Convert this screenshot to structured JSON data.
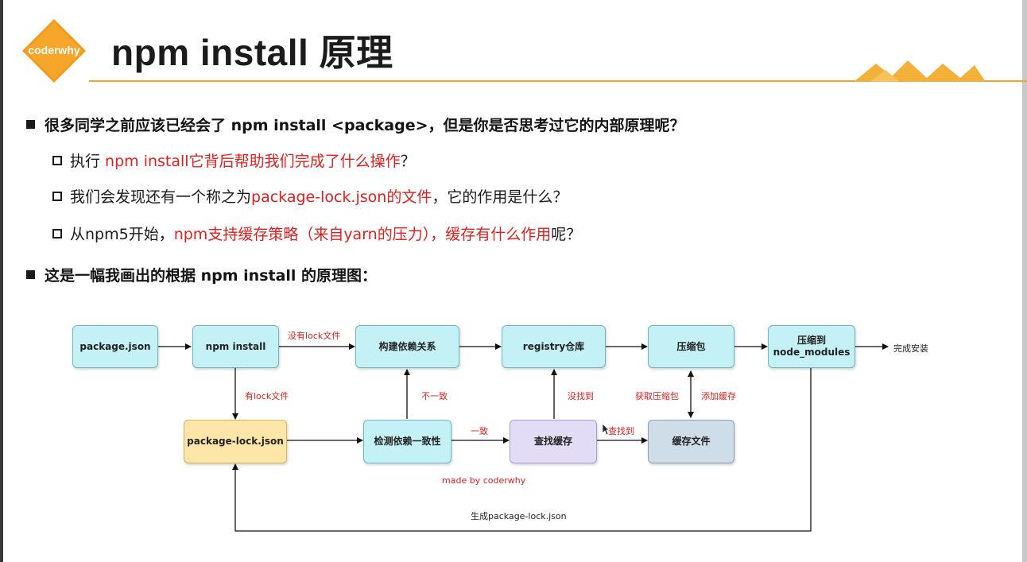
{
  "header": {
    "logo_text": "coderwhy",
    "title": "npm install 原理"
  },
  "bullets": {
    "b1": "很多同学之前应该已经会了 npm install <package>，但是你是否思考过它的内部原理呢？",
    "s1_a": "执行 ",
    "s1_b": "npm install它背后帮助我们完成了什么操作",
    "s1_c": "？",
    "s2_a": "我们会发现还有一个称之为",
    "s2_b": "package-lock.json的文件",
    "s2_c": "，它的作用是什么？",
    "s3_a": "从npm5开始，",
    "s3_b": "npm支持缓存策略（来自yarn的压力），缓存有什么作用",
    "s3_c": "呢？",
    "b2": "这是一幅我画出的根据 npm install 的原理图："
  },
  "diagram": {
    "nodes": {
      "package_json": "package.json",
      "npm_install": "npm install",
      "build_deps": "构建依赖关系",
      "registry": "registry仓库",
      "tarball": "压缩包",
      "extract_line1": "压缩到",
      "extract_line2": "node_modules",
      "package_lock": "package-lock.json",
      "check_consistency": "检测依赖一致性",
      "find_cache": "查找缓存",
      "cache_files": "缓存文件"
    },
    "labels": {
      "no_lock": "没有lock文件",
      "has_lock": "有lock文件",
      "inconsistent": "不一致",
      "consistent": "一致",
      "not_found": "没找到",
      "found": "查找到",
      "get_tarball": "获取压缩包",
      "add_cache": "添加缓存",
      "done": "完成安装",
      "made_by": "made by coderwhy",
      "generate_lock": "生成package-lock.json"
    },
    "colors": {
      "accent": "#f2a52b",
      "emphasis_red": "#e0201e",
      "node_cyan": "#c4f1f6",
      "node_yellow": "#fde6a8",
      "node_lilac": "#e2dcf6",
      "node_slate": "#cfdde8"
    }
  }
}
